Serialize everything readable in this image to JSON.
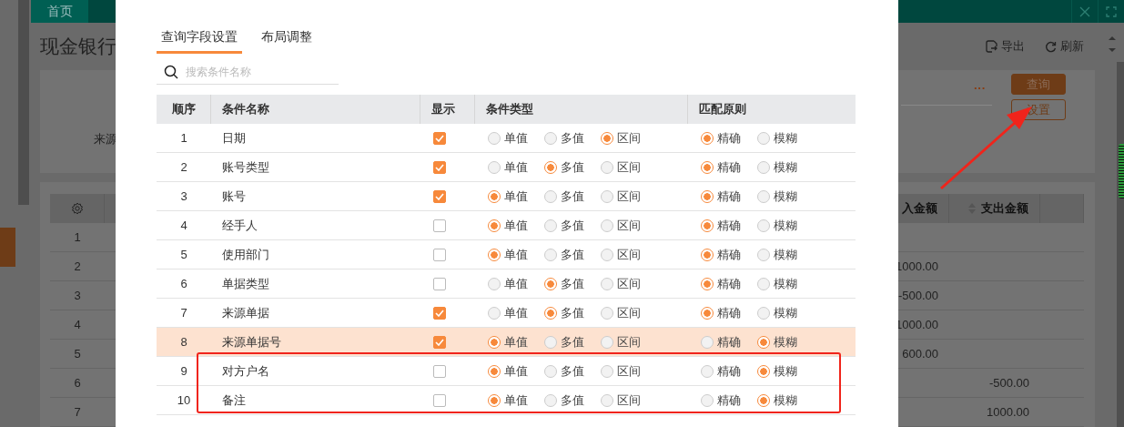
{
  "top_bar": {
    "tabs": [
      {
        "label": "首页"
      }
    ]
  },
  "page": {
    "title": "现金银行",
    "actions": [
      {
        "kind": "export",
        "label": "导出"
      },
      {
        "kind": "refresh",
        "label": "刷新"
      }
    ]
  },
  "filter": {
    "label": "来源",
    "more": "···",
    "buttons": [
      {
        "kind": "primary",
        "label": "查询"
      },
      {
        "kind": "outline",
        "label": "设置"
      }
    ]
  },
  "table": {
    "columns": [
      "入金额",
      "支出金额"
    ],
    "rows": [
      {
        "index": "1"
      },
      {
        "index": "2",
        "income": "1000.00"
      },
      {
        "index": "3",
        "income": "-500.00"
      },
      {
        "index": "4",
        "income": "1000.00"
      },
      {
        "index": "5",
        "income": "600.00"
      },
      {
        "index": "6",
        "expense": "-500.00"
      },
      {
        "index": "7",
        "expense": "1000.00"
      }
    ]
  },
  "dialog": {
    "tabs": [
      {
        "label": "查询字段设置",
        "selected": true
      },
      {
        "label": "布局调整",
        "selected": false
      }
    ],
    "search": {
      "placeholder": "搜索条件名称"
    },
    "columns": [
      "顺序",
      "条件名称",
      "显示",
      "条件类型",
      "匹配原则"
    ],
    "rows": [
      {
        "order": "1",
        "name": "日期",
        "show": true,
        "selected": false,
        "types": [
          {
            "label": "单值",
            "selected": false
          },
          {
            "label": "多值",
            "selected": false
          },
          {
            "label": "区间",
            "selected": true
          }
        ],
        "match": [
          {
            "label": "精确",
            "selected": true
          },
          {
            "label": "模糊",
            "selected": false
          }
        ]
      },
      {
        "order": "2",
        "name": "账号类型",
        "show": true,
        "selected": false,
        "types": [
          {
            "label": "单值",
            "selected": false
          },
          {
            "label": "多值",
            "selected": true
          },
          {
            "label": "区间",
            "selected": false
          }
        ],
        "match": [
          {
            "label": "精确",
            "selected": true
          },
          {
            "label": "模糊",
            "selected": false
          }
        ]
      },
      {
        "order": "3",
        "name": "账号",
        "show": true,
        "selected": false,
        "types": [
          {
            "label": "单值",
            "selected": true
          },
          {
            "label": "多值",
            "selected": false
          },
          {
            "label": "区间",
            "selected": false
          }
        ],
        "match": [
          {
            "label": "精确",
            "selected": true
          },
          {
            "label": "模糊",
            "selected": false
          }
        ]
      },
      {
        "order": "4",
        "name": "经手人",
        "show": false,
        "selected": false,
        "types": [
          {
            "label": "单值",
            "selected": true
          },
          {
            "label": "多值",
            "selected": false
          },
          {
            "label": "区间",
            "selected": false
          }
        ],
        "match": [
          {
            "label": "精确",
            "selected": true
          },
          {
            "label": "模糊",
            "selected": false
          }
        ]
      },
      {
        "order": "5",
        "name": "使用部门",
        "show": false,
        "selected": false,
        "types": [
          {
            "label": "单值",
            "selected": true
          },
          {
            "label": "多值",
            "selected": false
          },
          {
            "label": "区间",
            "selected": false
          }
        ],
        "match": [
          {
            "label": "精确",
            "selected": true
          },
          {
            "label": "模糊",
            "selected": false
          }
        ]
      },
      {
        "order": "6",
        "name": "单据类型",
        "show": false,
        "selected": false,
        "types": [
          {
            "label": "单值",
            "selected": false
          },
          {
            "label": "多值",
            "selected": true
          },
          {
            "label": "区间",
            "selected": false
          }
        ],
        "match": [
          {
            "label": "精确",
            "selected": true
          },
          {
            "label": "模糊",
            "selected": false
          }
        ]
      },
      {
        "order": "7",
        "name": "来源单据",
        "show": true,
        "selected": false,
        "types": [
          {
            "label": "单值",
            "selected": false
          },
          {
            "label": "多值",
            "selected": true
          },
          {
            "label": "区间",
            "selected": false
          }
        ],
        "match": [
          {
            "label": "精确",
            "selected": true
          },
          {
            "label": "模糊",
            "selected": false
          }
        ]
      },
      {
        "order": "8",
        "name": "来源单据号",
        "show": true,
        "selected": true,
        "types": [
          {
            "label": "单值",
            "selected": true
          },
          {
            "label": "多值",
            "selected": false
          },
          {
            "label": "区间",
            "selected": false
          }
        ],
        "match": [
          {
            "label": "精确",
            "selected": false
          },
          {
            "label": "模糊",
            "selected": true
          }
        ]
      },
      {
        "order": "9",
        "name": "对方户名",
        "show": false,
        "selected": false,
        "types": [
          {
            "label": "单值",
            "selected": true
          },
          {
            "label": "多值",
            "selected": false
          },
          {
            "label": "区间",
            "selected": false
          }
        ],
        "match": [
          {
            "label": "精确",
            "selected": false
          },
          {
            "label": "模糊",
            "selected": true
          }
        ]
      },
      {
        "order": "10",
        "name": "备注",
        "show": false,
        "selected": false,
        "types": [
          {
            "label": "单值",
            "selected": true
          },
          {
            "label": "多值",
            "selected": false
          },
          {
            "label": "区间",
            "selected": false
          }
        ],
        "match": [
          {
            "label": "精确",
            "selected": false
          },
          {
            "label": "模糊",
            "selected": true
          }
        ]
      }
    ]
  }
}
